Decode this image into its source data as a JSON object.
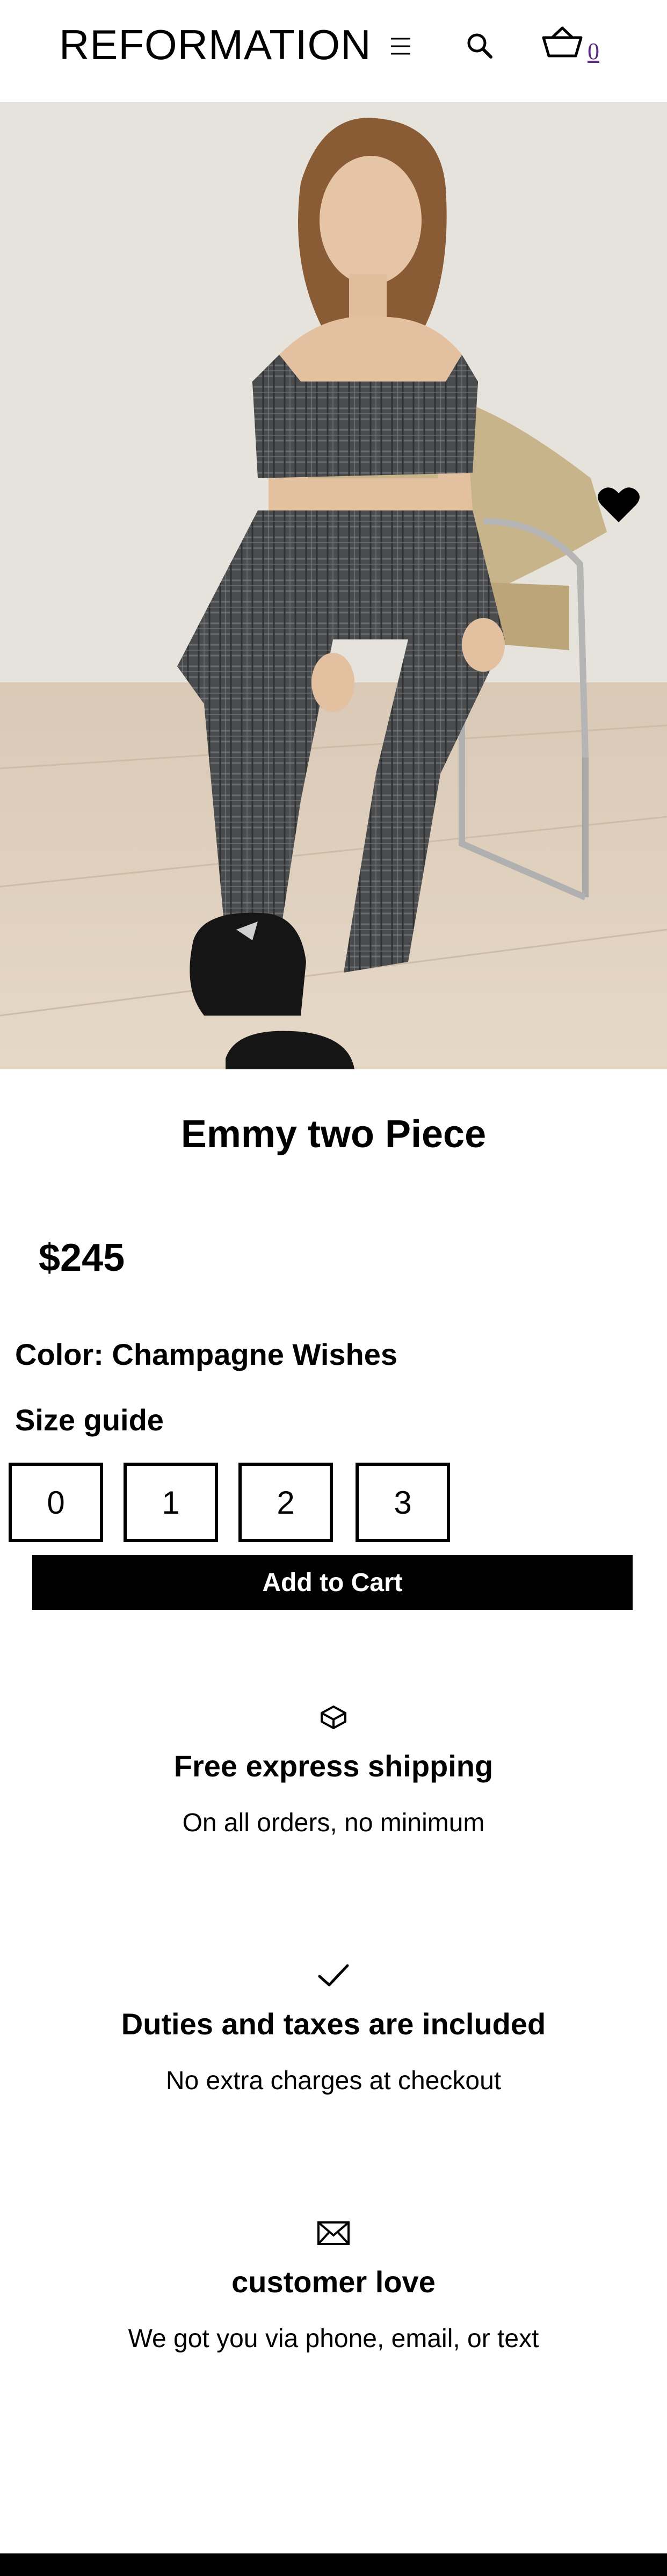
{
  "header": {
    "logo": "REFORMATION",
    "cart_count": "0",
    "icons": {
      "menu": "hamburger-icon",
      "search": "search-icon",
      "cart": "basket-icon"
    }
  },
  "product": {
    "image_alt": "Model wearing grey plaid crop top and pants seated on a chair",
    "title": "Emmy two Piece",
    "price": "$245",
    "color_label": "Color: Champagne Wishes",
    "size_guide": "Size guide",
    "sizes": [
      "0",
      "1",
      "2",
      "3"
    ],
    "add_to_cart": "Add to Cart",
    "wishlist_icon": "heart-icon"
  },
  "benefits": [
    {
      "icon": "box-icon",
      "title": "Free express shipping",
      "desc": "On all orders, no minimum"
    },
    {
      "icon": "check-icon",
      "title": "Duties and taxes are included",
      "desc": "No extra charges at checkout"
    },
    {
      "icon": "envelope-icon",
      "title": "customer love",
      "desc": "We got you via phone, email, or text"
    }
  ],
  "colors": {
    "primary": "#000000",
    "background": "#ffffff",
    "cart_count_link": "#5b2a86"
  }
}
